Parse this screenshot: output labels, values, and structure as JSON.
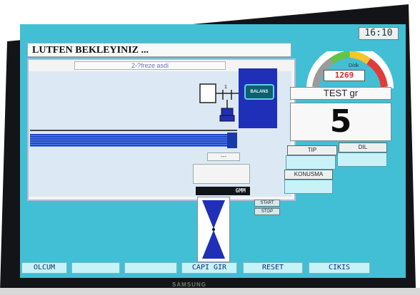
{
  "device": {
    "brand": "SAMSUNG"
  },
  "status": {
    "clock": "16:10",
    "header": "LUTFEN BEKLEYINIZ ...",
    "message": "2-?freze asdi"
  },
  "machine": {
    "balans_label": "BALANS",
    "spindle_number": "1",
    "readout": "---",
    "unit_label": "GMM"
  },
  "gauge": {
    "unit": "D/dk",
    "rpm_value": "1269",
    "colors": [
      "#e23b3b",
      "#f2c531",
      "#66c24c",
      "#9b9b9b"
    ]
  },
  "test": {
    "label": "TEST gr",
    "value": "5"
  },
  "side_buttons": {
    "tip": "TIP",
    "dil": "DIL",
    "konusma": "KONUSMA"
  },
  "controls": {
    "start": "START",
    "stop": "STOP"
  },
  "bottom_buttons": [
    "OLCUM",
    "",
    "",
    "CAPI GIR",
    "RESET",
    "CIKIS"
  ],
  "colors": {
    "screen_bg": "#42bfd4",
    "accent_blue": "#1f2fb8",
    "panel_bg": "#dce9f4"
  }
}
